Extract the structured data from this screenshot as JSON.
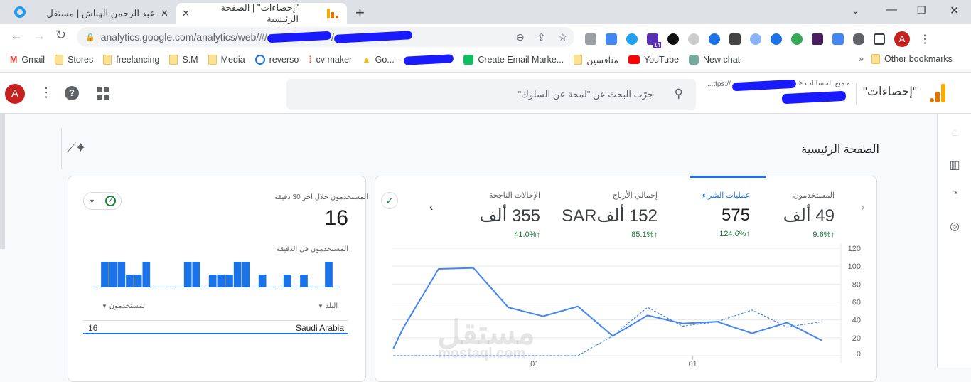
{
  "browser": {
    "tabs": [
      {
        "title": "عبد الرحمن الهباش | مستقل",
        "active": false
      },
      {
        "title": "\"إحصاءات\" | الصفحة الرئيسية",
        "active": true
      }
    ],
    "url": "analytics.google.com/analytics/web/#/",
    "bookmarks": [
      "Gmail",
      "Stores",
      "freelancing",
      "S.M",
      "Media",
      "reverso",
      "cv maker",
      "Go... -",
      "Create Email Marke...",
      "منافسين",
      "YouTube",
      "New chat"
    ],
    "other_bookmarks": "Other bookmarks",
    "overflow": "»",
    "profile_initial": "A",
    "extension_badge": "14"
  },
  "header": {
    "product": "\"إحصاءات\"",
    "breadcrumb": "جميع الحسابات",
    "property_url": "...ttps://",
    "search_placeholder": "جرّب البحث عن \"لمحة عن السلوك\"",
    "avatar": "A"
  },
  "page": {
    "title": "الصفحة الرئيسية"
  },
  "kpis": [
    {
      "label": "المستخدمون",
      "value": "49 ألف",
      "change": "9.6%",
      "selected": false
    },
    {
      "label": "عمليات الشراء",
      "value": "575",
      "change": "124.6%",
      "selected": true
    },
    {
      "label": "إجمالي الأرباح",
      "value": "152 ألفSAR",
      "change": "85.1%",
      "selected": false
    },
    {
      "label": "الإحالات الناجحة",
      "value": "355 ألف",
      "change": "41.0%",
      "selected": false
    }
  ],
  "realtime": {
    "title": "المستخدمون خلال آخر 30 دقيقة",
    "value": "16",
    "per_minute_label": "المستخدمون في الدقيقة",
    "per_minute": [
      0,
      2,
      2,
      2,
      1,
      1,
      2,
      0,
      0,
      0,
      0,
      2,
      2,
      0,
      1,
      1,
      1,
      2,
      2,
      0,
      1,
      0,
      0,
      1,
      0,
      1,
      0,
      0,
      2,
      0
    ],
    "col_country": "البلد",
    "col_users": "المستخدمون",
    "rows": [
      {
        "country": "Saudi Arabia",
        "users": "16"
      }
    ]
  },
  "chart_data": {
    "type": "line",
    "x": [
      0.7,
      1,
      2,
      3,
      4,
      5,
      6,
      7,
      8,
      9,
      10,
      11,
      12,
      13
    ],
    "series": [
      {
        "name": "current",
        "style": "solid",
        "values": [
          8,
          32,
          97,
          98,
          54,
          44,
          55,
          22,
          45,
          36,
          38,
          25,
          37,
          17
        ]
      },
      {
        "name": "previous",
        "style": "dashed",
        "values": [
          0,
          0,
          0,
          0,
          0,
          0,
          0,
          22,
          54,
          33,
          38,
          51,
          32,
          38
        ]
      }
    ],
    "yticks": [
      0,
      20,
      40,
      60,
      80,
      100,
      120
    ],
    "ylim": [
      0,
      120
    ],
    "xticks": [
      {
        "x": 4.76,
        "label": "01"
      },
      {
        "x": 9.3,
        "label": "01"
      }
    ],
    "color": "#4285f4"
  },
  "watermark": {
    "ar": "مستقل",
    "en": "mostaql.com"
  }
}
